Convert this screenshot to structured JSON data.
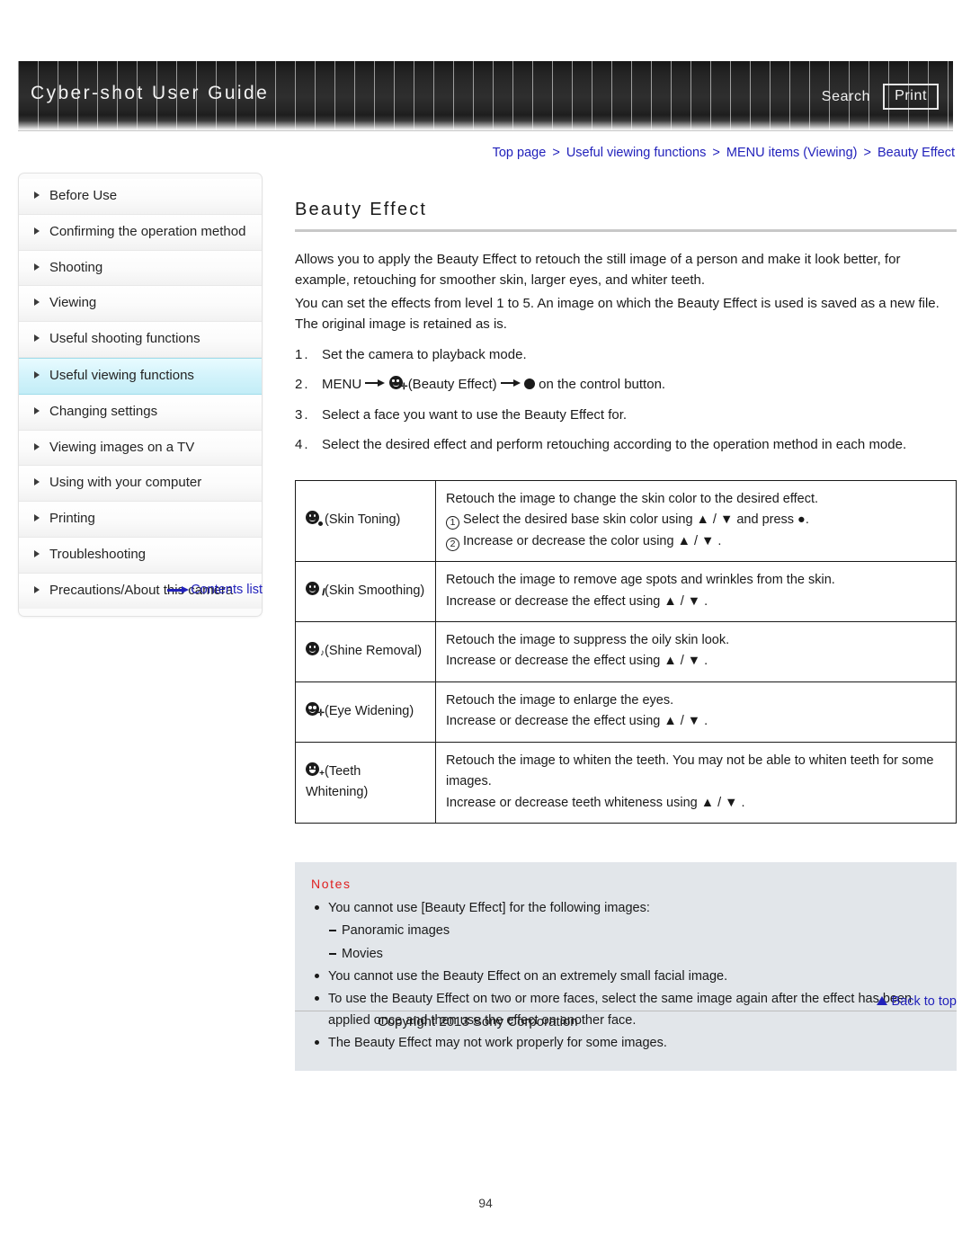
{
  "header": {
    "title": "Cyber-shot User Guide",
    "search_label": "Search",
    "print_label": "Print"
  },
  "breadcrumb": {
    "items": [
      "Top page",
      "Useful viewing functions",
      "MENU items (Viewing)",
      "Beauty Effect"
    ],
    "separator": ">"
  },
  "sidebar": {
    "items": [
      {
        "label": "Before Use",
        "active": false
      },
      {
        "label": "Confirming the operation method",
        "active": false
      },
      {
        "label": "Shooting",
        "active": false
      },
      {
        "label": "Viewing",
        "active": false
      },
      {
        "label": "Useful shooting functions",
        "active": false
      },
      {
        "label": "Useful viewing functions",
        "active": true
      },
      {
        "label": "Changing settings",
        "active": false
      },
      {
        "label": "Viewing images on a TV",
        "active": false
      },
      {
        "label": "Using with your computer",
        "active": false
      },
      {
        "label": "Printing",
        "active": false
      },
      {
        "label": "Troubleshooting",
        "active": false
      },
      {
        "label": "Precautions/About this camera",
        "active": false
      }
    ],
    "contents_list_label": "Contents list"
  },
  "main": {
    "title": "Beauty Effect",
    "intro_paragraphs": [
      "Allows you to apply the Beauty Effect to retouch the still image of a person and make it look better, for example, retouching for smoother skin, larger eyes, and whiter teeth.",
      "You can set the effects from level 1 to 5. An image on which the Beauty Effect is used is saved as a new file. The original image is retained as is."
    ],
    "steps": [
      {
        "num": "1.",
        "text": "Set the camera to playback mode."
      },
      {
        "num": "2.",
        "prefix": "MENU",
        "icon_label": "(Beauty Effect)",
        "suffix": "on the control button."
      },
      {
        "num": "3.",
        "text": "Select a face you want to use the Beauty Effect for."
      },
      {
        "num": "4.",
        "text": "Select the desired effect and perform retouching according to the operation method in each mode."
      }
    ],
    "effects_table": {
      "rows": [
        {
          "icon": "skin-toning-icon",
          "name": "(Skin Toning)",
          "lines": [
            "Retouch the image to change the skin color to the desired effect.",
            "Select the desired base skin color using  ▲ / ▼  and press  ●.",
            "Increase or decrease the color using  ▲ / ▼ ."
          ],
          "numbered_from": 1
        },
        {
          "icon": "skin-smoothing-icon",
          "name": "(Skin Smoothing)",
          "lines": [
            "Retouch the image to remove age spots and wrinkles from the skin.",
            "Increase or decrease the effect using  ▲ / ▼ ."
          ],
          "numbered_from": 0
        },
        {
          "icon": "shine-removal-icon",
          "name": "(Shine Removal)",
          "lines": [
            "Retouch the image to suppress the oily skin look.",
            "Increase or decrease the effect using  ▲ / ▼ ."
          ],
          "numbered_from": 0
        },
        {
          "icon": "eye-widening-icon",
          "name": "(Eye Widening)",
          "lines": [
            "Retouch the image to enlarge the eyes.",
            "Increase or decrease the effect using  ▲ / ▼ ."
          ],
          "numbered_from": 0
        },
        {
          "icon": "teeth-whitening-icon",
          "name": "(Teeth Whitening)",
          "lines": [
            "Retouch the image to whiten the teeth. You may not be able to whiten teeth for some images.",
            "Increase or decrease teeth whiteness using  ▲ / ▼ ."
          ],
          "numbered_from": 0
        }
      ]
    },
    "notes": {
      "title": "Notes",
      "items": [
        {
          "text": "You cannot use [Beauty Effect] for the following images:",
          "sub": false
        },
        {
          "text": "Panoramic images",
          "sub": true
        },
        {
          "text": "Movies",
          "sub": true
        },
        {
          "text": "You cannot use the Beauty Effect on an extremely small facial image.",
          "sub": false
        },
        {
          "text": "To use the Beauty Effect on two or more faces, select the same image again after the effect has been applied once and then use the effect on another face.",
          "sub": false
        },
        {
          "text": "The Beauty Effect may not work properly for some images.",
          "sub": false
        }
      ]
    }
  },
  "footer": {
    "back_to_top_label": "Back to top",
    "copyright": "Copyright 2013 Sony Corporation",
    "page_number": "94"
  },
  "colors": {
    "link": "#2222bb",
    "notes_title": "#e02020",
    "notes_bg": "#e2e6ea",
    "active_nav": "#c3edf7"
  }
}
